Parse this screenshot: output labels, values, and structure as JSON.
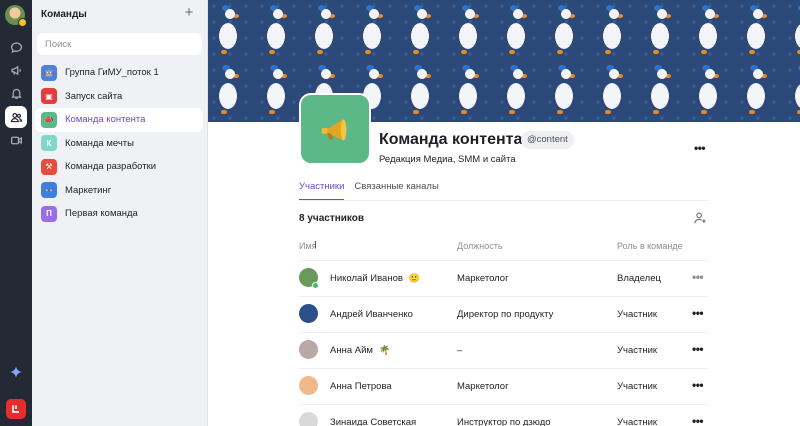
{
  "rail": {
    "icons": [
      "chat-icon",
      "megaphone-icon",
      "bell-icon",
      "users-icon",
      "video-icon"
    ],
    "active": "users-icon"
  },
  "sidebar": {
    "title": "Команды",
    "search_placeholder": "Поиск",
    "items": [
      {
        "label": "Группа ГиМУ_поток 1",
        "icon_color": "#4d7fe0",
        "icon_text": "🤖"
      },
      {
        "label": "Запуск сайта",
        "icon_color": "#e53c3c",
        "icon_text": "▣"
      },
      {
        "label": "Команда контента",
        "icon_color": "#5cb887",
        "icon_text": "📣"
      },
      {
        "label": "Команда мечты",
        "icon_color": "#7fd9c6",
        "icon_text": "К"
      },
      {
        "label": "Команда разработки",
        "icon_color": "#e84b3c",
        "icon_text": "⚒"
      },
      {
        "label": "Маркетинг",
        "icon_color": "#3f7fe0",
        "icon_text": "👓"
      },
      {
        "label": "Первая команда",
        "icon_color": "#9a6ee8",
        "icon_text": "П"
      }
    ],
    "active_index": 2
  },
  "team": {
    "name": "Команда контента",
    "handle": "@content",
    "description": "Редакция Медиа, SMM и сайта"
  },
  "tabs": [
    {
      "label": "Участники",
      "active": true
    },
    {
      "label": "Связанные каналы",
      "active": false
    }
  ],
  "members": {
    "count_label": "8 участников",
    "columns": {
      "name": "Имя",
      "position": "Должность",
      "role": "Роль в команде"
    },
    "rows": [
      {
        "name": "Николай Иванов",
        "status": "🙂",
        "position": "Маркетолог",
        "role": "Владелец",
        "avatar_color": "#6a9a5a",
        "online": true
      },
      {
        "name": "Андрей Иванченко",
        "status": "",
        "position": "Директор по продукту",
        "role": "Участник",
        "avatar_color": "#2c4f8a",
        "online": false
      },
      {
        "name": "Анна Айм",
        "status": "🌴",
        "position": "–",
        "role": "Участник",
        "avatar_color": "#b9a8a4",
        "online": false
      },
      {
        "name": "Анна Петрова",
        "status": "",
        "position": "Маркетолог",
        "role": "Участник",
        "avatar_color": "#f0b98a",
        "online": false
      },
      {
        "name": "Зинаида Советская",
        "status": "",
        "position": "Инструктор по дзюдо",
        "role": "Участник",
        "avatar_color": "#d9d9d9",
        "online": false
      }
    ]
  }
}
